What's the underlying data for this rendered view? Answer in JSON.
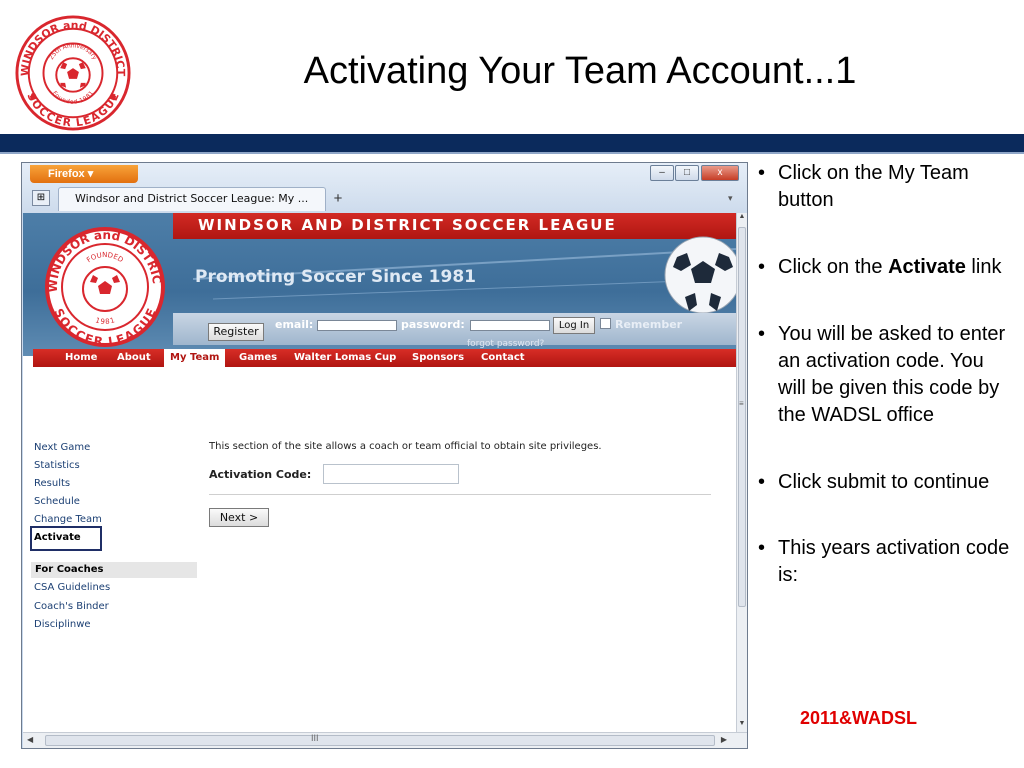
{
  "slide": {
    "title": "Activating Your Team Account...1",
    "logo_text": {
      "top": "WINDSOR and DISTRICT",
      "bottom": "SOCCER LEAGUE",
      "inner_top": "25th Anniversary",
      "inner_bottom": "Founded 1981"
    },
    "accent_color": "#0b2a5c"
  },
  "browser": {
    "app_button": "Firefox",
    "tab_title": "Windsor and District Soccer League: My ...",
    "new_tab": "+",
    "window_controls": {
      "minimize": "–",
      "maximize": "□",
      "close": "x"
    },
    "hscroll_grip": "III"
  },
  "site": {
    "name": "WINDSOR AND DISTRICT SOCCER LEAGUE",
    "tagline": "Promoting Soccer Since 1981",
    "logo_text": {
      "top": "WINDSOR and DISTRICT",
      "bottom": "SOCCER LEAGUE",
      "inner_top": "FOUNDED",
      "inner_bottom": "1981"
    },
    "login": {
      "register": "Register",
      "email_label": "email:",
      "password_label": "password:",
      "login_button": "Log In",
      "remember": "Remember",
      "forgot": "forgot password?"
    },
    "nav": [
      {
        "label": "Home"
      },
      {
        "label": "About"
      },
      {
        "label": "My Team",
        "active": true
      },
      {
        "label": "Games"
      },
      {
        "label": "Walter Lomas Cup"
      },
      {
        "label": "Sponsors"
      },
      {
        "label": "Contact"
      }
    ],
    "sidebar": {
      "team_links": [
        "Next Game",
        "Statistics",
        "Results",
        "Schedule",
        "Change Team",
        "Activate"
      ],
      "coaches_heading": "For Coaches",
      "coach_links": [
        "CSA Guidelines",
        "Coach's Binder",
        "Disciplinwe"
      ]
    },
    "content": {
      "description": "This section of the site allows a coach or team official to obtain site privileges.",
      "code_label": "Activation Code:",
      "code_value": "",
      "next_button": "Next >"
    }
  },
  "instructions": {
    "b1": "Click on the My Team button",
    "b2_prefix": "Click on the ",
    "b2_bold": "Activate",
    "b2_suffix": " link",
    "b3": "You will be asked to enter an activation code. You will be given this code by the WADSL office",
    "b4": "Click submit to continue",
    "b5": "This years activation code is:",
    "code": "2011&WADSL",
    "code_color": "#e00000"
  }
}
